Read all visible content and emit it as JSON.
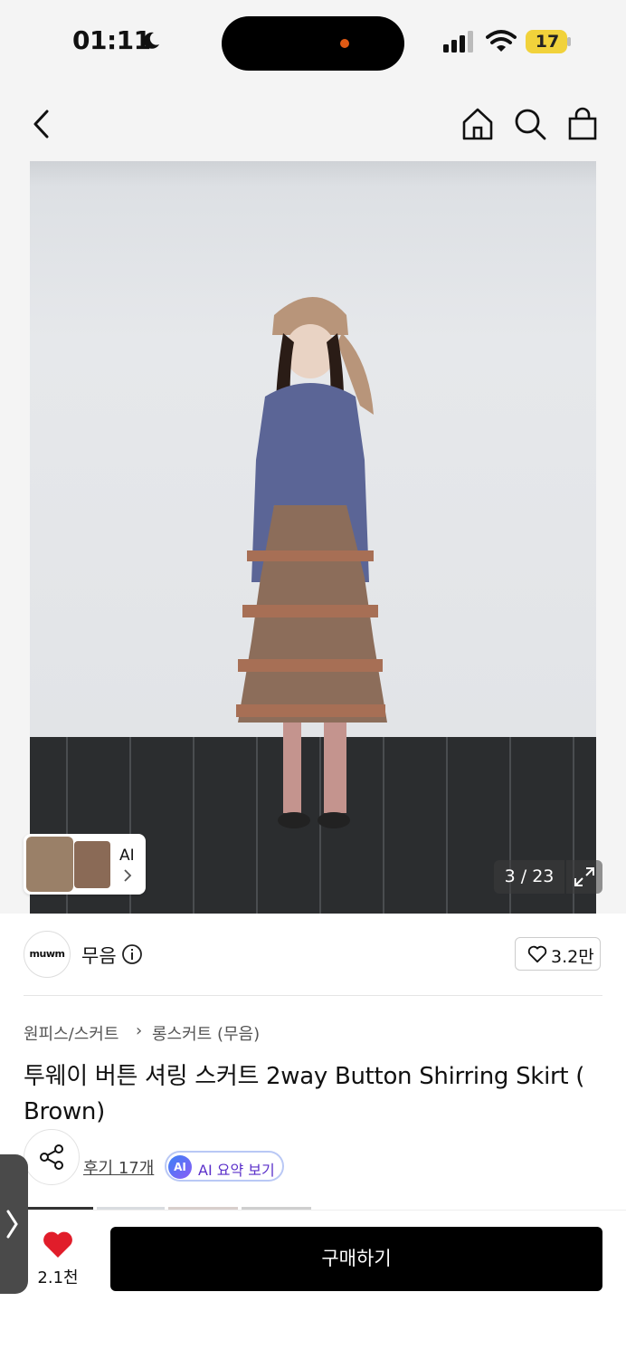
{
  "status": {
    "time": "01:11",
    "battery": "17"
  },
  "gallery": {
    "counter": "3 / 23",
    "ai_label": "AI"
  },
  "brand": {
    "logo_text": "muwm",
    "name": "무음",
    "likes": "3.2만"
  },
  "breadcrumb": {
    "category": "원피스/스커트",
    "separator": "›",
    "subcategory": "롱스커트 (무음)"
  },
  "product": {
    "title": "투웨이 버튼 셔링 스커트 2way Button Shirring Skirt ( Brown)"
  },
  "reviews": {
    "label": "후기 17개"
  },
  "ai_summary": {
    "badge": "AI",
    "label": "AI 요약 보기"
  },
  "bottom": {
    "like_count": "2.1천",
    "buy_label": "구매하기"
  },
  "colors": {
    "heart": "#e11d2a",
    "buy_button": "#000000",
    "ai_text": "#5a2fc9"
  }
}
